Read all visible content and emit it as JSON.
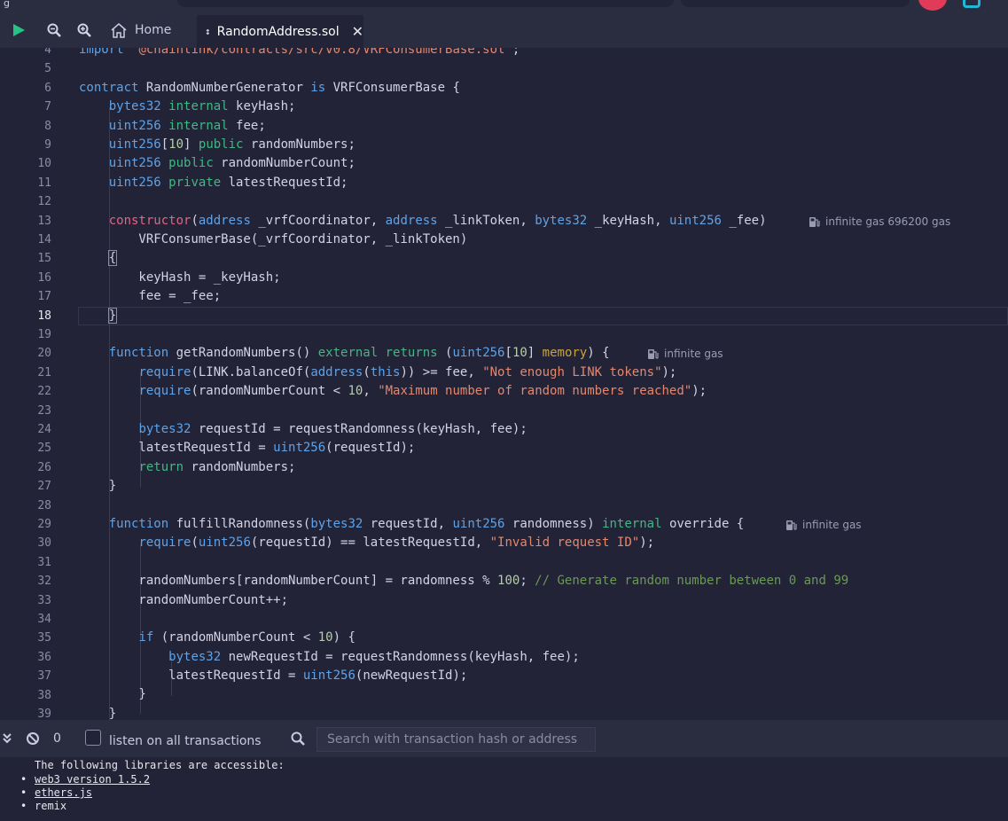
{
  "colors": {
    "background": "#222336",
    "panel": "#2a2c3f",
    "keyword": "#5ea3e8",
    "modifier": "#41b883",
    "string": "#e5876d",
    "comment": "#6a9955",
    "run": "#24c486"
  },
  "toolbar": {
    "run_icon": "play-icon",
    "zoom_out_icon": "zoom-out-icon",
    "zoom_in_icon": "zoom-in-icon"
  },
  "tabs": [
    {
      "label": "Home",
      "icon": "home-icon",
      "active": false
    },
    {
      "label": "RandomAddress.sol",
      "icon": "solidity-icon",
      "active": true,
      "close_icon": "close-icon"
    }
  ],
  "editor": {
    "line_numbers": [
      "4",
      "5",
      "6",
      "7",
      "8",
      "9",
      "10",
      "11",
      "12",
      "13",
      "14",
      "15",
      "16",
      "17",
      "18",
      "19",
      "20",
      "21",
      "22",
      "23",
      "24",
      "25",
      "26",
      "27",
      "28",
      "29",
      "30",
      "31",
      "32",
      "33",
      "34",
      "35",
      "36",
      "37",
      "38",
      "39"
    ],
    "current_line": "18",
    "gas_hints": {
      "constructor": "infinite gas 696200 gas",
      "getRandomNumbers": "infinite gas",
      "fulfillRandomness": "infinite gas"
    }
  },
  "terminal": {
    "collapse_icon": "chevron-double-down-icon",
    "clear_icon": "clear-icon",
    "pending_count": "0",
    "listen_label": "listen on all transactions",
    "search_placeholder": "Search with transaction hash or address",
    "intro": "The following libraries are accessible:",
    "libraries": [
      "web3 version 1.5.2",
      "ethers.js",
      "remix"
    ]
  }
}
